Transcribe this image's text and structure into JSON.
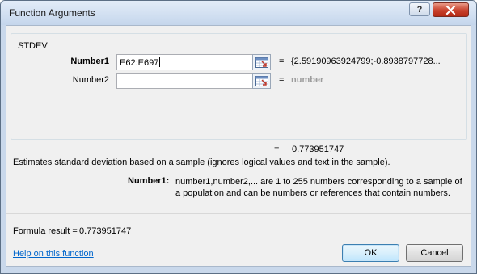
{
  "window": {
    "title": "Function Arguments",
    "help_glyph": "?"
  },
  "group": {
    "label": "STDEV"
  },
  "arguments": [
    {
      "label": "Number1",
      "value": "E62:E697",
      "equals": "=",
      "result": "{2.59190963924799;-0.8938797728..."
    },
    {
      "label": "Number2",
      "value": "",
      "equals": "=",
      "result": "number"
    }
  ],
  "result": {
    "equals": "=",
    "value": "0.773951747"
  },
  "description": "Estimates standard deviation based on a sample (ignores logical values and text in the sample).",
  "arg_help": {
    "label": "Number1:",
    "text": "number1,number2,... are 1 to 255 numbers corresponding to a sample of a population and can be numbers or references that contain numbers."
  },
  "formula_result": {
    "label": "Formula result =",
    "value": "0.773951747"
  },
  "help_link": "Help on this function",
  "buttons": {
    "ok": "OK",
    "cancel": "Cancel"
  }
}
